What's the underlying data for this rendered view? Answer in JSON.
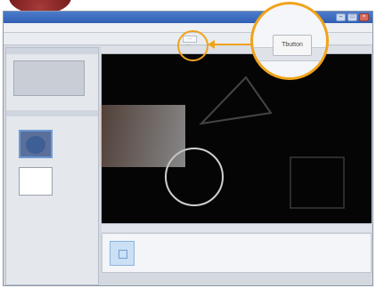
{
  "window": {
    "title": "",
    "controls": {
      "minimize": "–",
      "maximize": "□",
      "close": "×"
    }
  },
  "menubar": {
    "items": [
      "",
      "",
      "",
      ""
    ]
  },
  "toolbar": {
    "small_button_label": "···"
  },
  "left_panel": {
    "preview_label": ""
  },
  "callout": {
    "zoom_button_label": "Tbutton"
  },
  "colors": {
    "accent": "#f0a31a",
    "canvas": "#050505",
    "titlebar": "#2f5fb3"
  },
  "icons": {
    "callout_arrow": "arrow-left-icon"
  }
}
